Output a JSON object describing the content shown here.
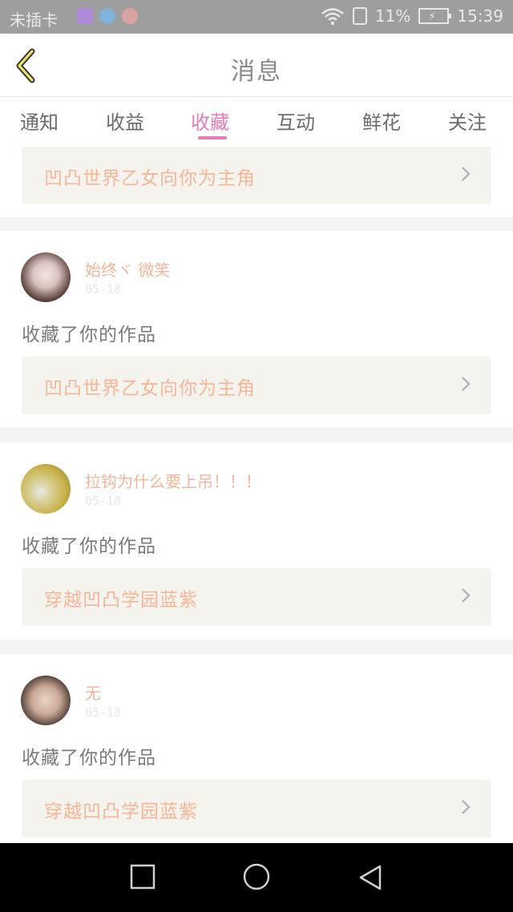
{
  "status_bar": {
    "carrier": "未插卡",
    "battery_percent": "11%",
    "time": "15:39"
  },
  "header": {
    "title": "消息"
  },
  "tabs": [
    {
      "label": "通知"
    },
    {
      "label": "收益"
    },
    {
      "label": "收藏"
    },
    {
      "label": "互动"
    },
    {
      "label": "鲜花"
    },
    {
      "label": "关注"
    }
  ],
  "active_tab": "收藏",
  "messages": [
    {
      "work_title": "凹凸世界乙女向你为主角"
    },
    {
      "username": "始终ヾ 微笑",
      "date": "05-18",
      "action": "收藏了你的作品",
      "work_title": "凹凸世界乙女向你为主角"
    },
    {
      "username": "拉钩为什么要上吊！！！",
      "date": "05-18",
      "action": "收藏了你的作品",
      "work_title": "穿越凹凸学园蓝紫"
    },
    {
      "username": "无",
      "date": "05-18",
      "action": "收藏了你的作品",
      "work_title": "穿越凹凸学园蓝紫"
    }
  ],
  "colors": {
    "accent": "#e77bb2",
    "username": "#f2b79b",
    "work_title": "#f5b697"
  }
}
